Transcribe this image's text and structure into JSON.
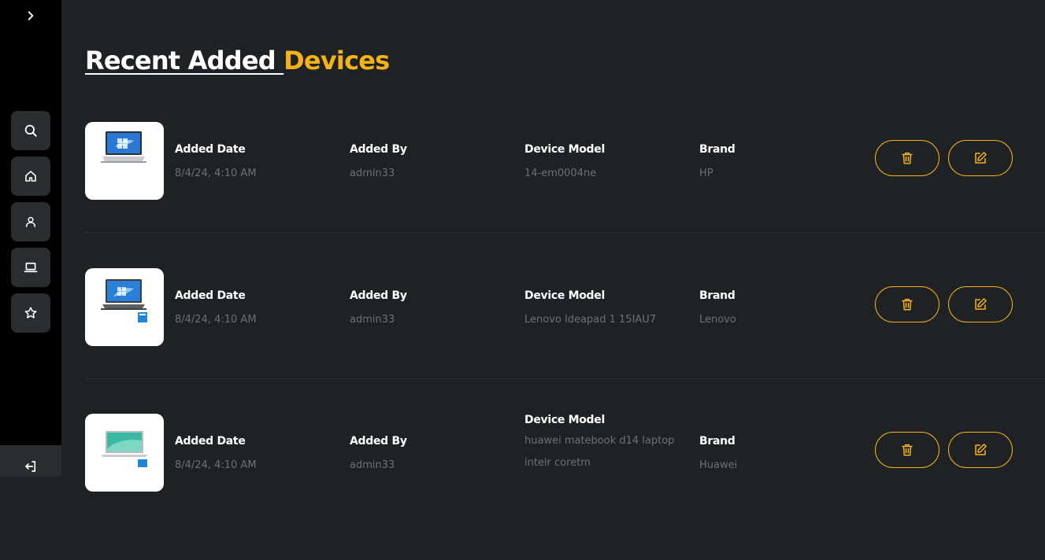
{
  "sidebar": {
    "expand_icon": "chevron-right-icon",
    "nav_items": [
      {
        "name": "search",
        "icon": "search-icon"
      },
      {
        "name": "home",
        "icon": "home-icon"
      },
      {
        "name": "profile",
        "icon": "user-icon"
      },
      {
        "name": "devices",
        "icon": "laptop-icon"
      },
      {
        "name": "favorites",
        "icon": "star-icon"
      }
    ],
    "logout_icon": "logout-icon"
  },
  "header": {
    "title_part1": "Recent Added ",
    "title_part2": "Devices"
  },
  "colors": {
    "accent": "#f5b316",
    "background": "#1f2224",
    "sidebar": "#000000",
    "muted_text": "#6c7175"
  },
  "labels": {
    "added_date": "Added Date",
    "added_by": "Added By",
    "device_model": "Device Model",
    "brand": "Brand"
  },
  "devices": [
    {
      "added_date": "8/4/24, 4:10 AM",
      "added_by": "admin33",
      "device_model": "14-em0004ne",
      "brand": "HP"
    },
    {
      "added_date": "8/4/24, 4:10 AM",
      "added_by": "admin33",
      "device_model": "Lenovo Ideapad 1 15IAU7",
      "brand": "Lenovo"
    },
    {
      "added_date": "8/4/24, 4:10 AM",
      "added_by": "admin33",
      "device_model": "huawei matebook d14 laptop intelr coretm",
      "brand": "Huawei"
    }
  ]
}
